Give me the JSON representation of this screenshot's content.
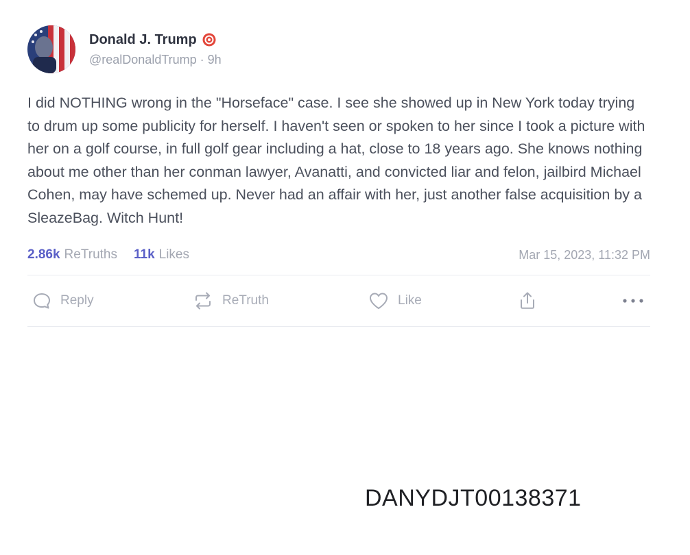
{
  "post": {
    "author": {
      "display_name": "Donald J. Trump",
      "handle": "@realDonaldTrump",
      "separator": " · ",
      "age": "9h",
      "avatar_icon": "profile-photo-flag",
      "verified_icon": "verified-badge-icon",
      "verified_color": "#e3463a"
    },
    "text": "I did NOTHING wrong in the \"Horseface\" case. I see she showed up in New York today trying to drum up some publicity for herself. I haven't seen or spoken to her since I took a picture with her on a golf course, in full golf gear including a hat, close to 18 years ago. She knows nothing about me other than her conman lawyer, Avanatti, and convicted liar and felon, jailbird Michael Cohen, may have schemed up. Never had an affair with her, just another false acquisition by a SleazeBag. Witch Hunt!",
    "stats": {
      "retruths_count": "2.86k",
      "retruths_label": "ReTruths",
      "likes_count": "11k",
      "likes_label": "Likes",
      "accent_color": "#5a5fc7"
    },
    "timestamp": "Mar 15, 2023, 11:32 PM",
    "actions": {
      "reply": "Reply",
      "retruth": "ReTruth",
      "like": "Like",
      "share_icon": "share-icon",
      "more_icon": "more-icon"
    }
  },
  "bates_number": "DANYDJT00138371"
}
